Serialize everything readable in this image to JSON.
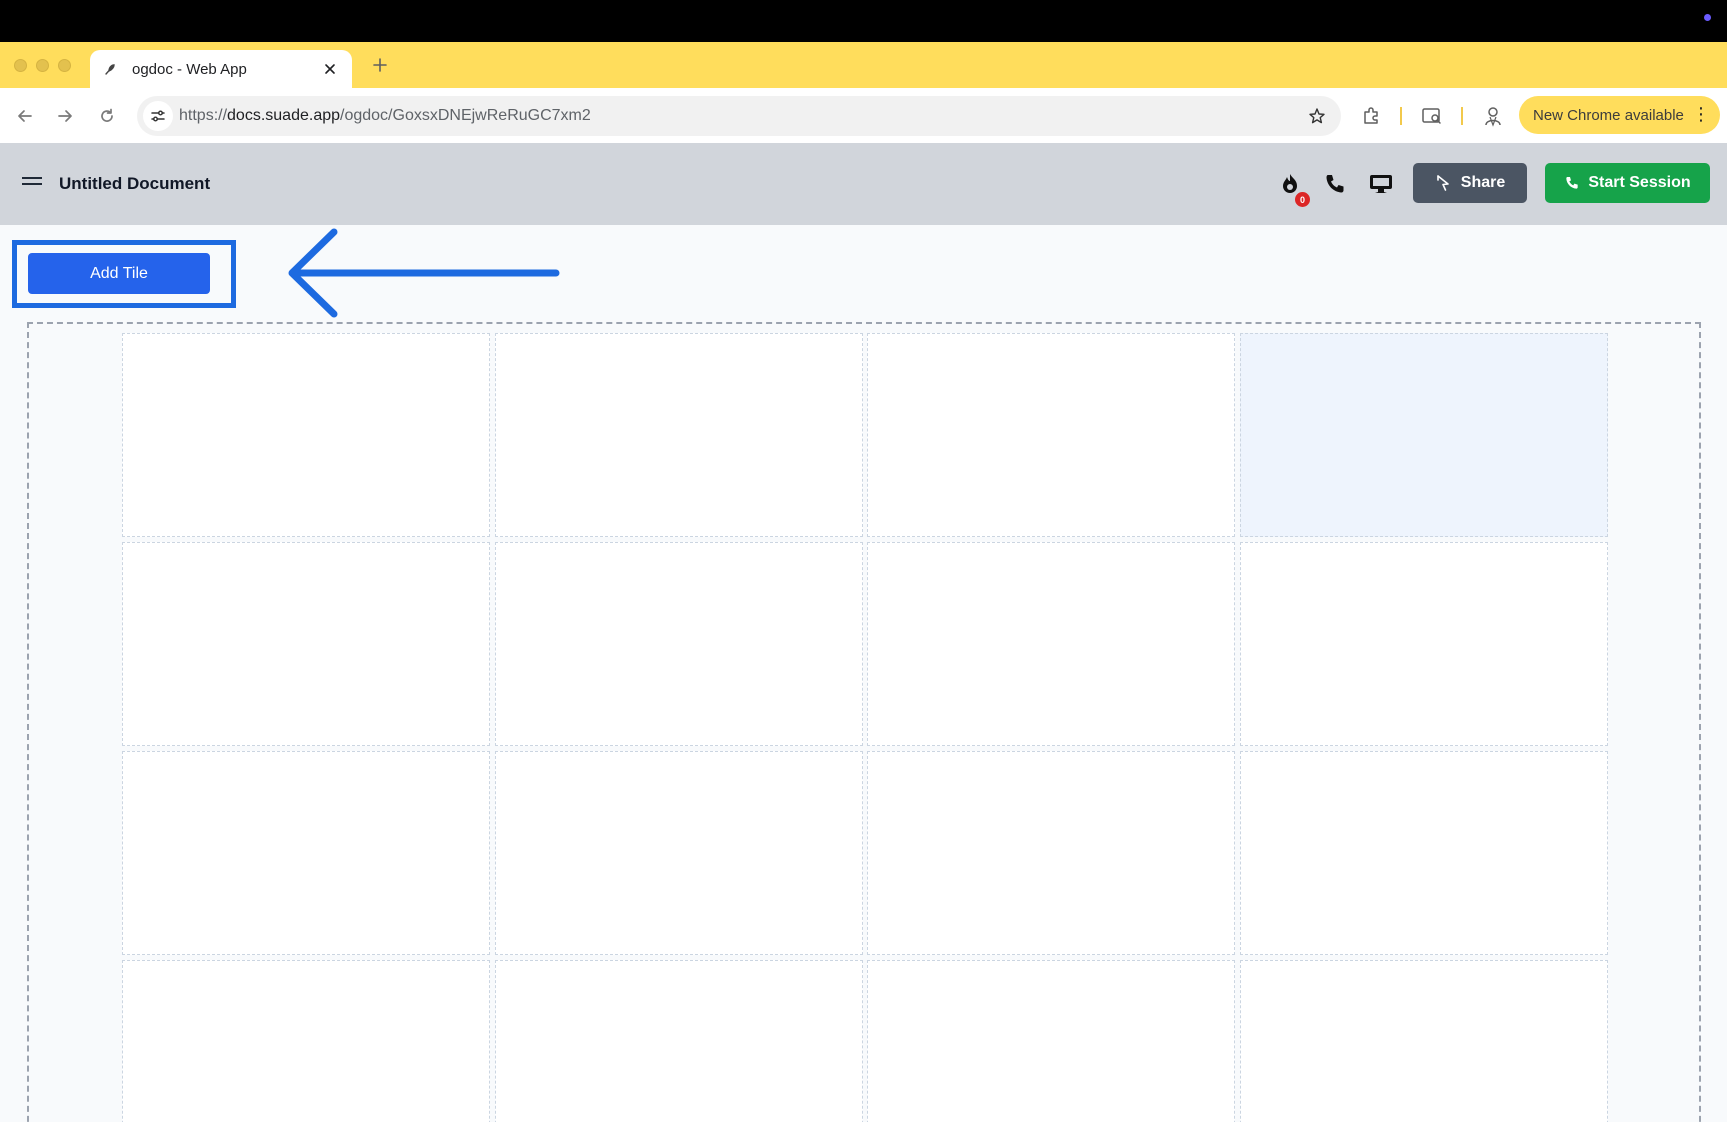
{
  "browser": {
    "tab_title": "ogdoc - Web App",
    "url_scheme": "https://",
    "url_host": "docs.suade.app",
    "url_path": "/ogdoc/GoxsxDNEjwReRuGC7xm2",
    "update_label": "New Chrome available"
  },
  "app": {
    "doc_title": "Untitled Document",
    "notification_count": "0",
    "share_label": "Share",
    "start_session_label": "Start Session"
  },
  "main": {
    "add_tile_label": "Add Tile",
    "grid": {
      "columns": 4,
      "rows": 4,
      "highlighted_tile": "row 1, column 4"
    }
  },
  "colors": {
    "tabstrip": "#ffdd5c",
    "header": "#d1d5db",
    "primary_button": "#2563eb",
    "share_button": "#4b5563",
    "start_button": "#16a34a",
    "annotation": "#1d6ae0",
    "tile_highlight": "#eef4fd"
  },
  "icons": {
    "favicon": "feather-icon",
    "streak": "fire-icon",
    "call": "phone-icon",
    "screen": "monitor-icon",
    "share": "cursor-share-icon",
    "start": "phone-icon"
  }
}
